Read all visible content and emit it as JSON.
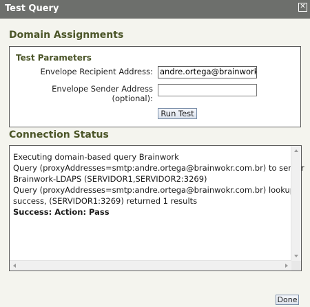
{
  "window": {
    "title": "Test Query",
    "close_glyph": "✕"
  },
  "domain_assignments": {
    "title": "Domain Assignments"
  },
  "test_parameters": {
    "title": "Test Parameters",
    "recipient_label": "Envelope Recipient Address:",
    "recipient_value": "andre.ortega@brainwork.c",
    "sender_label_line1": "Envelope Sender Address",
    "sender_label_line2": "(optional):",
    "sender_value": "",
    "run_button": "Run Test"
  },
  "connection_status": {
    "title": "Connection Status",
    "lines": [
      "Executing domain-based query Brainwork",
      "Query (proxyAddresses=smtp:andre.ortega@brainwokr.com.br) to server",
      "Brainwork-LDAPS (SERVIDOR1,SERVIDOR2:3269)",
      "Query (proxyAddresses=smtp:andre.ortega@brainwokr.com.br) lookup",
      "success, (SERVIDOR1:3269) returned 1 results",
      "Success: Action: Pass"
    ]
  },
  "footer": {
    "done_button": "Done"
  },
  "colors": {
    "titlebar": "#6d6f6c",
    "section_title": "#4b5528",
    "dialog_background": "#f4f4ee"
  }
}
